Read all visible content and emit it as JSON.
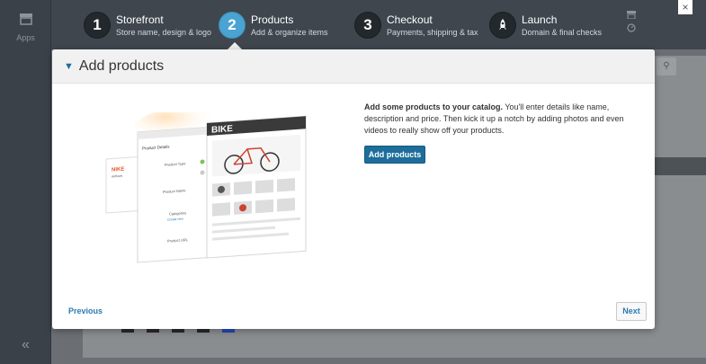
{
  "sidebar": {
    "apps_label": "Apps",
    "collapse_glyph": "«"
  },
  "wizard": {
    "steps": [
      {
        "number": "1",
        "title": "Storefront",
        "subtitle": "Store name, design & logo"
      },
      {
        "number": "2",
        "title": "Products",
        "subtitle": "Add & organize items"
      },
      {
        "number": "3",
        "title": "Checkout",
        "subtitle": "Payments, shipping & tax"
      },
      {
        "number": "",
        "title": "Launch",
        "subtitle": "Domain & final checks"
      }
    ],
    "active_step": 2,
    "close_glyph": "×"
  },
  "modal": {
    "title": "Add products",
    "description_bold": "Add some products to your catalog.",
    "description_rest": " You'll enter details like name, description and price. Then kick it up a notch by adding photos and even videos to really show off your products.",
    "add_button": "Add products",
    "previous_link": "Previous",
    "next_button": "Next"
  },
  "illustration": {
    "brand_left": "NIKE",
    "left_sub": "Airflows",
    "form_title": "Product Details",
    "form_fields": [
      "Product Type",
      "Product Name",
      "Categories",
      "Product URL"
    ],
    "create_new": "Create new",
    "brand_right": "BIKE"
  },
  "colors": {
    "accent": "#4aa3d1",
    "primary_button": "#1d6e9a",
    "link": "#2a7bb0",
    "chrome_bg": "#3f464e"
  }
}
